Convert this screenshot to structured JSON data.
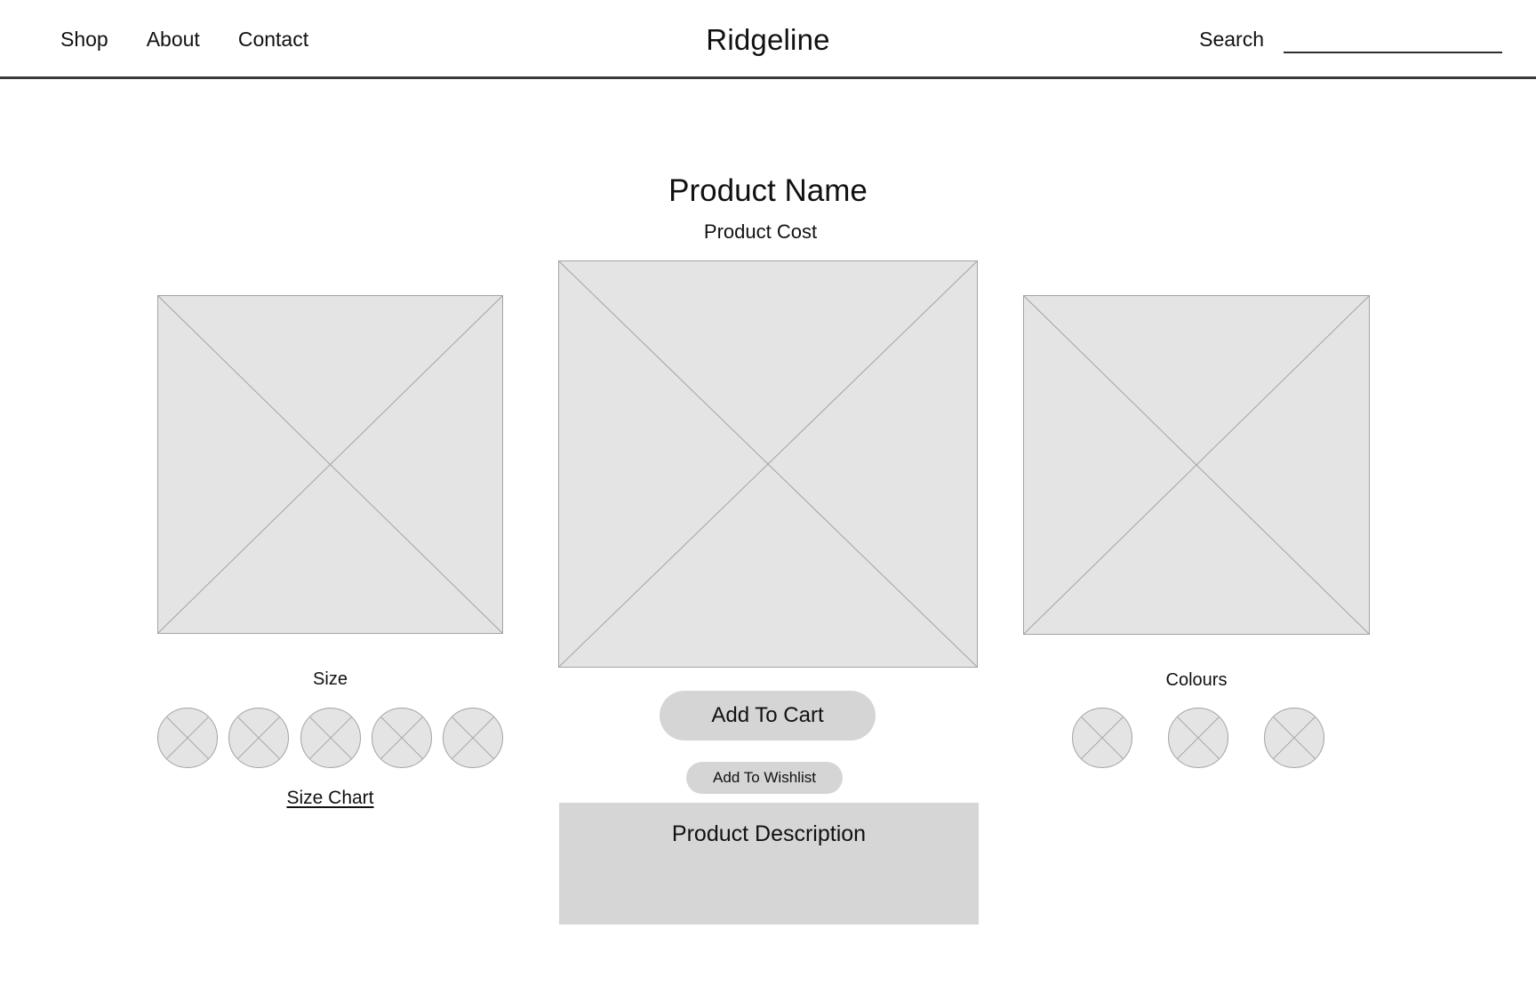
{
  "header": {
    "brand": "Ridgeline",
    "nav": [
      {
        "label": "Shop"
      },
      {
        "label": "About"
      },
      {
        "label": "Contact"
      }
    ],
    "search": {
      "label": "Search",
      "value": "",
      "placeholder": ""
    },
    "divider_color": "#3a3a3a"
  },
  "product": {
    "name": "Product Name",
    "cost": "Product Cost",
    "description_title": "Product Description",
    "gallery": [
      {
        "name": "left-thumbnail",
        "alt": "image-placeholder"
      },
      {
        "name": "main-image",
        "alt": "image-placeholder"
      },
      {
        "name": "right-thumbnail",
        "alt": "image-placeholder"
      }
    ]
  },
  "size": {
    "label": "Size",
    "chart_link": "Size Chart",
    "options": [
      {
        "name": "size-option-1"
      },
      {
        "name": "size-option-2"
      },
      {
        "name": "size-option-3"
      },
      {
        "name": "size-option-4"
      },
      {
        "name": "size-option-5"
      }
    ]
  },
  "colours": {
    "label": "Colours",
    "options": [
      {
        "name": "colour-option-1"
      },
      {
        "name": "colour-option-2"
      },
      {
        "name": "colour-option-3"
      }
    ]
  },
  "actions": {
    "add_to_cart": "Add To Cart",
    "add_to_wishlist": "Add To Wishlist"
  },
  "colors": {
    "placeholder_fill": "#e4e4e4",
    "placeholder_stroke": "#a3a3a3",
    "button_fill": "#d5d5d5",
    "description_fill": "#d6d6d6",
    "text": "#111111",
    "page_background": "#ffffff"
  }
}
